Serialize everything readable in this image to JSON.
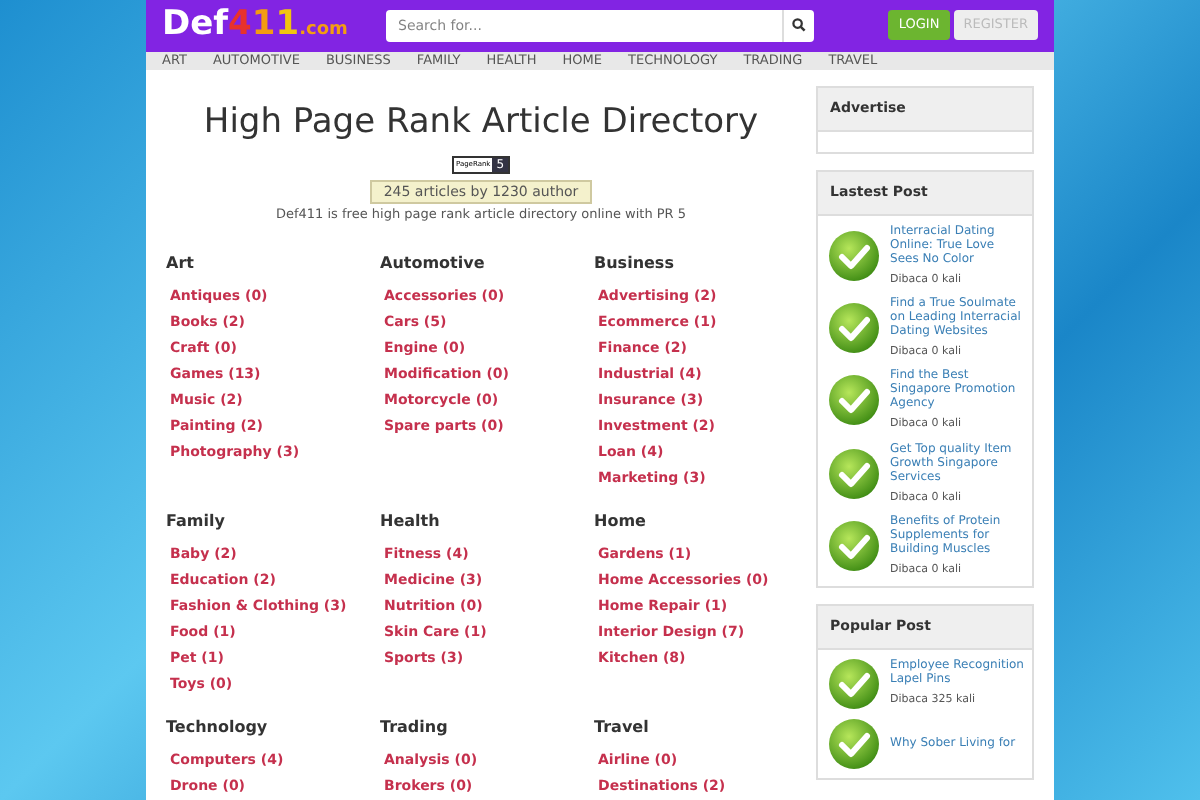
{
  "logo": {
    "parts": [
      {
        "text": "Def",
        "color": "#ffffff"
      },
      {
        "text": "4",
        "color": "#e8322c"
      },
      {
        "text": "1",
        "color": "#f39c12"
      },
      {
        "text": "1",
        "color": "#f1c40f"
      },
      {
        "text": ".com",
        "color": "#f39c12"
      }
    ]
  },
  "search": {
    "placeholder": "Search for..."
  },
  "buttons": [
    {
      "label": "LOGIN",
      "kind": "primary"
    },
    {
      "label": "REGISTER",
      "kind": "secondary"
    }
  ],
  "nav": [
    "ART",
    "AUTOMOTIVE",
    "BUSINESS",
    "FAMILY",
    "HEALTH",
    "HOME",
    "TECHNOLOGY",
    "TRADING",
    "TRAVEL"
  ],
  "title": "High Page Rank Article Directory",
  "pagerank": {
    "label": "PageRank",
    "value": "5"
  },
  "stats": "245 articles by 1230 author",
  "description": "Def411 is free high page rank article directory online with PR 5",
  "categories": [
    {
      "name": "Art",
      "items": [
        "Antiques (0)",
        "Books (2)",
        "Craft (0)",
        "Games (13)",
        "Music (2)",
        "Painting (2)",
        "Photography (3)"
      ]
    },
    {
      "name": "Automotive",
      "items": [
        "Accessories (0)",
        "Cars (5)",
        "Engine (0)",
        "Modification (0)",
        "Motorcycle (0)",
        "Spare parts (0)"
      ]
    },
    {
      "name": "Business",
      "items": [
        "Advertising (2)",
        "Ecommerce (1)",
        "Finance (2)",
        "Industrial (4)",
        "Insurance (3)",
        "Investment (2)",
        "Loan (4)",
        "Marketing (3)"
      ]
    },
    {
      "name": "Family",
      "items": [
        "Baby (2)",
        "Education (2)",
        "Fashion & Clothing (3)",
        "Food (1)",
        "Pet (1)",
        "Toys (0)"
      ]
    },
    {
      "name": "Health",
      "items": [
        "Fitness (4)",
        "Medicine (3)",
        "Nutrition (0)",
        "Skin Care (1)",
        "Sports (3)"
      ]
    },
    {
      "name": "Home",
      "items": [
        "Gardens (1)",
        "Home Accessories (0)",
        "Home Repair (1)",
        "Interior Design (7)",
        "Kitchen (8)"
      ]
    },
    {
      "name": "Technology",
      "items": [
        "Computers (4)",
        "Drone (0)"
      ]
    },
    {
      "name": "Trading",
      "items": [
        "Analysis (0)",
        "Brokers (0)"
      ]
    },
    {
      "name": "Travel",
      "items": [
        "Airline (0)",
        "Destinations (2)"
      ]
    }
  ],
  "sidebar": [
    {
      "title": "Advertise"
    },
    {
      "title": "Lastest Post",
      "posts": [
        {
          "title": "Interracial Dating Online: True Love Sees No Color",
          "views": "Dibaca 0 kali"
        },
        {
          "title": "Find a True Soulmate on Leading Interracial Dating Websites",
          "views": "Dibaca 0 kali"
        },
        {
          "title": "Find the Best Singapore Promotion Agency",
          "views": "Dibaca 0 kali"
        },
        {
          "title": "Get Top quality Item Growth Singapore Services",
          "views": "Dibaca 0 kali"
        },
        {
          "title": "Benefits of Protein Supplements for Building Muscles",
          "views": "Dibaca 0 kali"
        }
      ]
    },
    {
      "title": "Popular Post",
      "posts": [
        {
          "title": "Employee Recognition Lapel Pins",
          "views": "Dibaca 325 kali"
        },
        {
          "title": "Why Sober Living for"
        }
      ]
    }
  ]
}
